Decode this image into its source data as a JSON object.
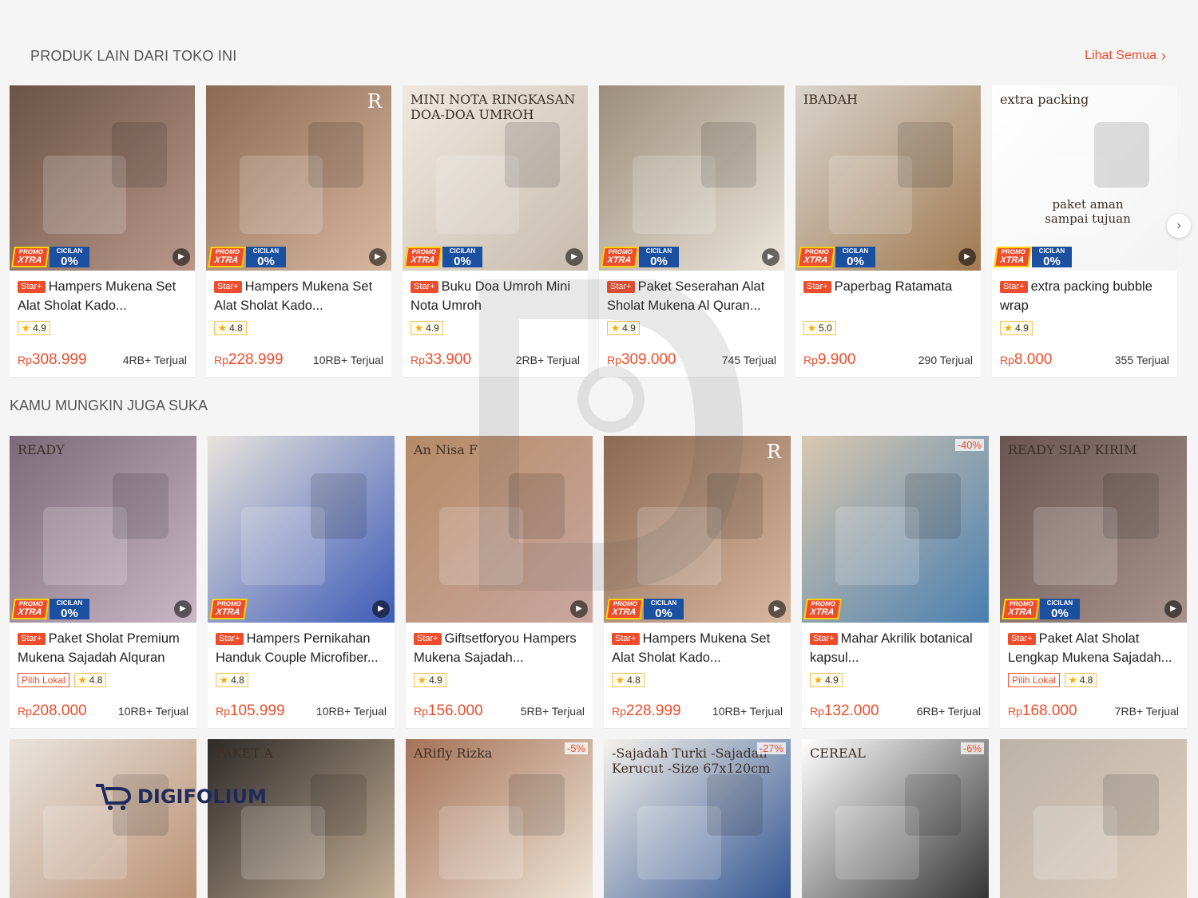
{
  "section1": {
    "title": "PRODUK LAIN DARI TOKO INI",
    "see_all": "Lihat Semua",
    "see_all_icon": "chevron-right-icon"
  },
  "section2": {
    "title": "KAMU MUNGKIN JUGA SUKA"
  },
  "badges": {
    "promo_top": "PROMO",
    "promo_xtra": "XTRA",
    "cicilan": "CICILAN",
    "cicilan_pct": "0%",
    "star": "Star+",
    "local": "Pilih Lokal",
    "currency": "Rp"
  },
  "row1": [
    {
      "name": "Hampers Mukena Set Alat Sholat Kado...",
      "rating": "4.9",
      "price": "308.999",
      "sold": "4RB+ Terjual",
      "promo": true,
      "cicilan": true,
      "video": true,
      "bg": [
        "#6b5345",
        "#b9988a"
      ]
    },
    {
      "name": "Hampers Mukena Set Alat Sholat Kado...",
      "rating": "4.8",
      "price": "228.999",
      "sold": "10RB+ Terjual",
      "promo": true,
      "cicilan": true,
      "video": true,
      "bg": [
        "#8a6a52",
        "#d8b8a0"
      ],
      "overlay": "R"
    },
    {
      "name": "Buku Doa Umroh Mini Nota Umroh",
      "rating": "4.9",
      "price": "33.900",
      "sold": "2RB+ Terjual",
      "promo": true,
      "cicilan": true,
      "video": true,
      "bg": [
        "#efe8e0",
        "#c8bcae"
      ],
      "overlay": "MINI NOTA RINGKASAN DOA-DOA UMROH"
    },
    {
      "name": "Paket Seserahan Alat Sholat Mukena Al Quran...",
      "rating": "4.9",
      "price": "309.000",
      "sold": "745 Terjual",
      "promo": true,
      "cicilan": true,
      "video": true,
      "bg": [
        "#9c8e7a",
        "#ece6dc"
      ]
    },
    {
      "name": "Paperbag Ratamata",
      "rating": "5.0",
      "price": "9.900",
      "sold": "290 Terjual",
      "promo": true,
      "cicilan": true,
      "video": true,
      "bg": [
        "#d9d4cc",
        "#a07a52"
      ],
      "overlay": "IBADAH"
    },
    {
      "name": "extra packing bubble wrap",
      "rating": "4.9",
      "price": "8.000",
      "sold": "355 Terjual",
      "promo": true,
      "cicilan": true,
      "video": false,
      "bg": [
        "#ffffff",
        "#f3f3f3"
      ],
      "overlay": "extra packing",
      "overlay2": "paket aman sampai tujuan"
    }
  ],
  "row2": [
    {
      "name": "Paket Sholat Premium Mukena Sajadah Alquran",
      "local": true,
      "rating": "4.8",
      "price": "208.000",
      "sold": "10RB+ Terjual",
      "promo": true,
      "cicilan": true,
      "video": true,
      "bg": [
        "#7d6a78",
        "#c9b7c6"
      ],
      "overlay": "READY"
    },
    {
      "name": "Hampers Pernikahan Handuk Couple Microfiber...",
      "local": false,
      "rating": "4.8",
      "price": "105.999",
      "sold": "10RB+ Terjual",
      "promo": true,
      "cicilan": false,
      "video": true,
      "bg": [
        "#e8e3dc",
        "#3d5bb8"
      ]
    },
    {
      "name": "Giftsetforyou Hampers Mukena Sajadah...",
      "local": false,
      "rating": "4.9",
      "price": "156.000",
      "sold": "5RB+ Terjual",
      "promo": false,
      "cicilan": false,
      "video": true,
      "bg": [
        "#b58b66",
        "#c9a7a0"
      ],
      "overlay": "An Nisa F"
    },
    {
      "name": "Hampers Mukena Set Alat Sholat Kado...",
      "local": false,
      "rating": "4.8",
      "price": "228.999",
      "sold": "10RB+ Terjual",
      "promo": true,
      "cicilan": true,
      "video": true,
      "bg": [
        "#8a6a52",
        "#d8b8a0"
      ],
      "overlay": "R"
    },
    {
      "name": "Mahar Akrilik botanical kapsul...",
      "local": false,
      "rating": "4.9",
      "price": "132.000",
      "sold": "6RB+ Terjual",
      "promo": true,
      "cicilan": false,
      "video": false,
      "discount": "-40%",
      "bg": [
        "#d9c8b0",
        "#4a7fb0"
      ]
    },
    {
      "name": "Paket Alat Sholat Lengkap Mukena Sajadah...",
      "local": true,
      "rating": "4.8",
      "price": "168.000",
      "sold": "7RB+ Terjual",
      "promo": true,
      "cicilan": true,
      "video": true,
      "bg": [
        "#6a5552",
        "#a8948c"
      ],
      "overlay": "READY SIAP KIRIM"
    }
  ],
  "row3": [
    {
      "bg": [
        "#e9e4de",
        "#b98e70"
      ],
      "discount": ""
    },
    {
      "bg": [
        "#2e2a28",
        "#cbb59a"
      ],
      "discount": "",
      "overlay": "PAKET A"
    },
    {
      "bg": [
        "#a57258",
        "#f2eadc"
      ],
      "discount": "-5%",
      "overlay": "ARifly Rizka"
    },
    {
      "bg": [
        "#f5f1ea",
        "#2a4f8f"
      ],
      "discount": "-27%",
      "overlay": "-Sajadah Turki -Sajadah Kerucut -Size 67x120cm"
    },
    {
      "bg": [
        "#ffffff",
        "#2b2b2b"
      ],
      "discount": "-6%",
      "overlay": "CEREAL"
    },
    {
      "bg": [
        "#bcb3a8",
        "#e0cfbd"
      ],
      "discount": ""
    }
  ],
  "next_icon": "chevron-right-icon",
  "watermark": {
    "text": "DIGIFOLIUM"
  }
}
